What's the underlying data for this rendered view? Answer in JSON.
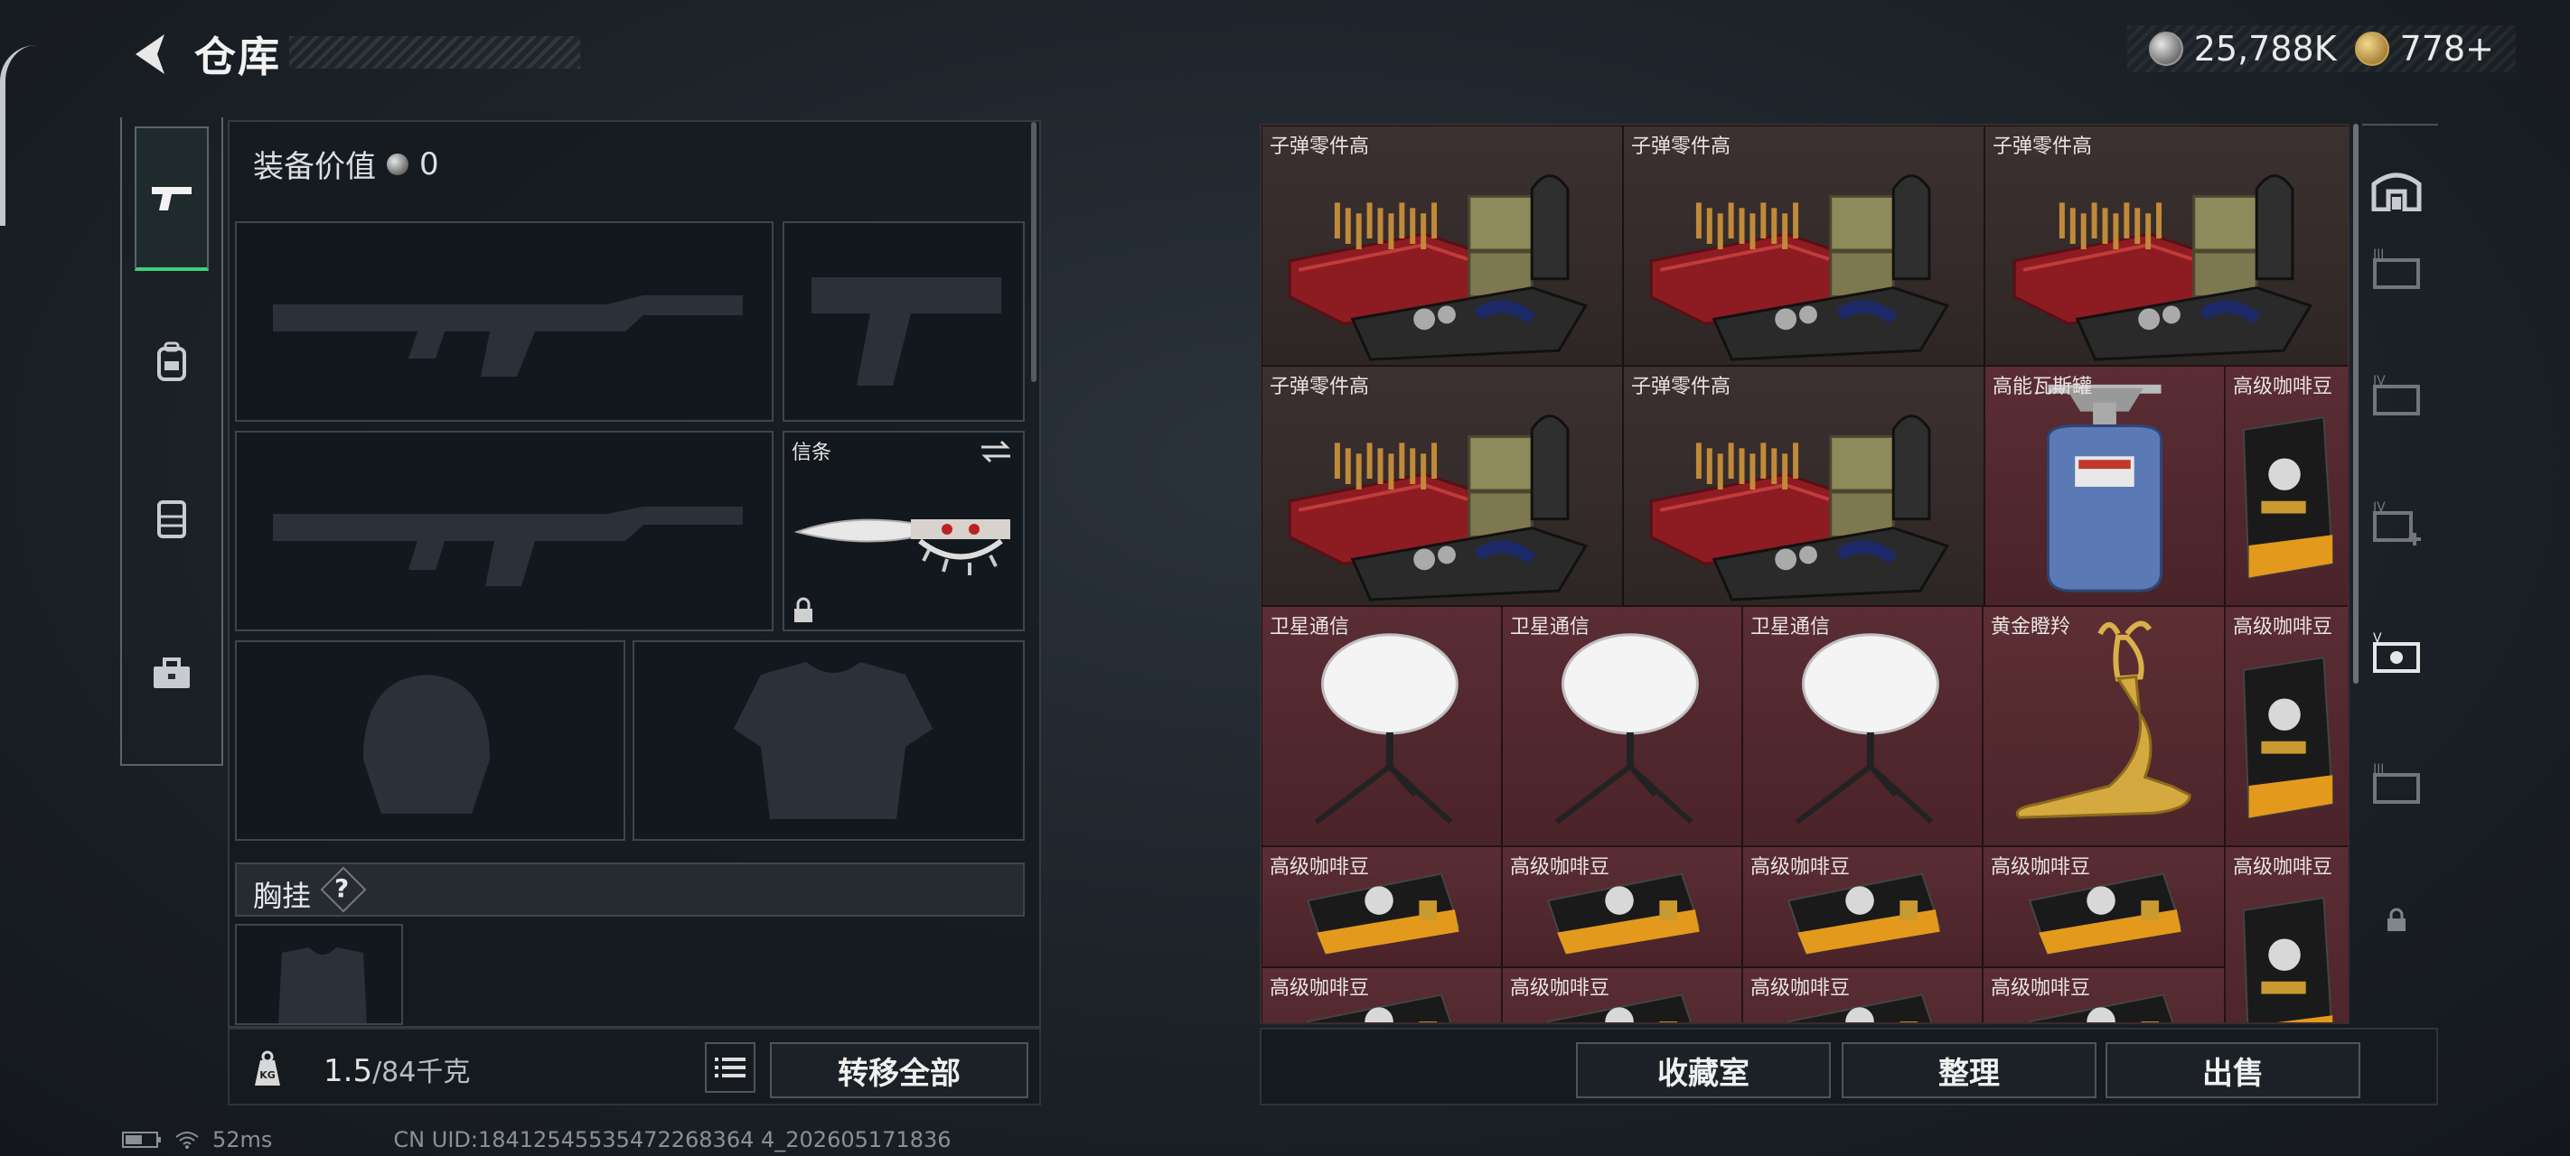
{
  "header": {
    "title": "仓库"
  },
  "currency": [
    {
      "icon": "silver-coin-icon",
      "value": "25,788K"
    },
    {
      "icon": "gold-coin-icon",
      "value": "778+"
    }
  ],
  "tabs": [
    {
      "name": "weapon-tab-icon",
      "active": true
    },
    {
      "name": "backpack-tab-icon",
      "active": false
    },
    {
      "name": "rig-tab-icon",
      "active": false
    },
    {
      "name": "toolbox-tab-icon",
      "active": false
    }
  ],
  "equipment": {
    "value_label": "装备价值",
    "value": "0",
    "melee_label": "信条",
    "chest_label": "胸挂",
    "chest_help": "?"
  },
  "weight": {
    "current": "1.5",
    "max": "/84千克"
  },
  "bottom": {
    "transfer_all": "转移全部"
  },
  "status": {
    "ping": "52ms",
    "uid": "CN UID:18412545535472268364 4_202605171836"
  },
  "grid": {
    "items": [
      {
        "label": "子弹零件高",
        "kind": "bullet"
      },
      {
        "label": "子弹零件高",
        "kind": "bullet"
      },
      {
        "label": "子弹零件高",
        "kind": "bullet"
      },
      {
        "label": "子弹零件高",
        "kind": "bullet"
      },
      {
        "label": "子弹零件高",
        "kind": "bullet"
      },
      {
        "label": "高能瓦斯罐",
        "kind": "gas"
      },
      {
        "label": "高级咖啡豆",
        "kind": "coffee-bag"
      },
      {
        "label": "卫星通信",
        "kind": "satellite"
      },
      {
        "label": "卫星通信",
        "kind": "satellite"
      },
      {
        "label": "卫星通信",
        "kind": "satellite"
      },
      {
        "label": "黄金瞪羚",
        "kind": "gazelle"
      },
      {
        "label": "高级咖啡豆",
        "kind": "coffee-bag"
      },
      {
        "label": "高级咖啡豆",
        "kind": "coffee-flat"
      },
      {
        "label": "高级咖啡豆",
        "kind": "coffee-flat"
      },
      {
        "label": "高级咖啡豆",
        "kind": "coffee-flat"
      },
      {
        "label": "高级咖啡豆",
        "kind": "coffee-flat"
      },
      {
        "label": "高级咖啡豆",
        "kind": "coffee-bag"
      },
      {
        "label": "高级咖啡豆",
        "kind": "coffee-flat"
      },
      {
        "label": "高级咖啡豆",
        "kind": "coffee-flat"
      },
      {
        "label": "高级咖啡豆",
        "kind": "coffee-flat"
      },
      {
        "label": "高级咖啡豆",
        "kind": "coffee-flat"
      }
    ]
  },
  "actions": {
    "collection": "收藏室",
    "sort": "整理",
    "sell": "出售"
  },
  "side_icons": [
    "vault-icon",
    "storage-iii-icon",
    "storage-iv-icon",
    "storage-iv-add-icon",
    "storage-v-icon",
    "storage-iii-b-icon",
    "lock-icon",
    "settings-icon"
  ],
  "colors": {
    "accent": "#3fd07e",
    "item_red": "#5a2d34",
    "item_brown": "#3b3130"
  }
}
